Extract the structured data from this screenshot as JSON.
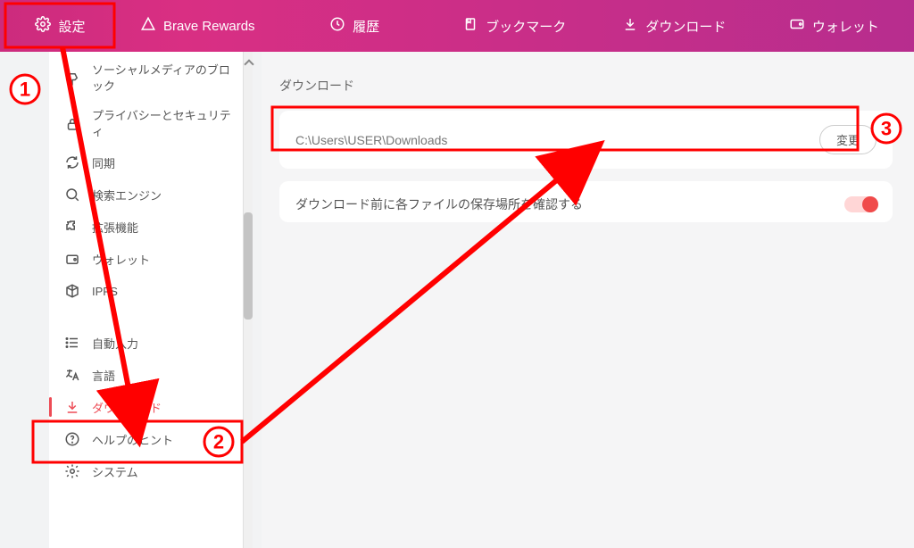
{
  "topbar": {
    "settings": "設定",
    "rewards": "Brave Rewards",
    "history": "履歴",
    "bookmarks": "ブックマーク",
    "downloads": "ダウンロード",
    "wallet": "ウォレット"
  },
  "sidebar": {
    "social_block": "ソーシャルメディアのブロック",
    "privacy": "プライバシーとセキュリティ",
    "sync": "同期",
    "search": "検索エンジン",
    "extensions": "拡張機能",
    "wallet": "ウォレット",
    "ipfs": "IPFS",
    "autofill": "自動入力",
    "language": "言語",
    "download": "ダウンロード",
    "help": "ヘルプのヒント",
    "system": "システム"
  },
  "main": {
    "section_title": "ダウンロード",
    "download_path": "C:\\Users\\USER\\Downloads",
    "change_button": "変更",
    "confirm_label": "ダウンロード前に各ファイルの保存場所を確認する",
    "confirm_enabled": true
  },
  "annotations": {
    "step1": "1",
    "step2": "2",
    "step3": "3"
  },
  "colors": {
    "accent": "#ed4b55",
    "annotation": "#ff0000",
    "topbar_gradient_start": "#cc2b7d",
    "topbar_gradient_end": "#b72d8e"
  }
}
